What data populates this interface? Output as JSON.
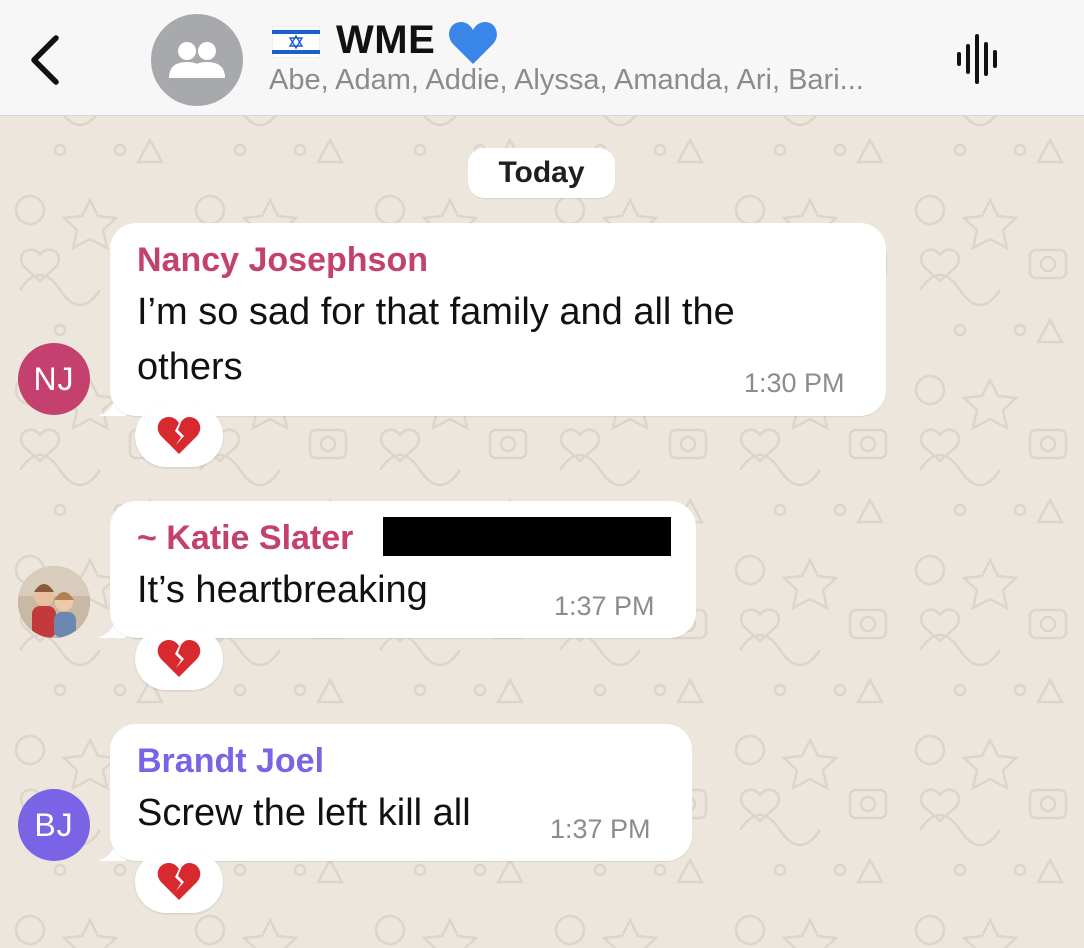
{
  "header": {
    "back_icon": "chevron-left-icon",
    "group_avatar_icon": "people-icon",
    "flag_icon": "israel-flag-icon",
    "title": "WME",
    "heart_icon": "blue-heart-icon",
    "members": "Abe, Adam, Addie, Alyssa, Amanda, Ari, Bari...",
    "audio_icon": "audio-waveform-icon"
  },
  "date_separator": "Today",
  "messages": [
    {
      "sender": "Nancy Josephson",
      "sender_color": "#c4406f",
      "avatar_initials": "NJ",
      "avatar_color": "#c4406f",
      "text_line1": "I’m so sad for that family and all the",
      "text_line2": "others",
      "time": "1:30 PM",
      "reaction": "broken-heart-icon"
    },
    {
      "sender": "~ Katie Slater",
      "sender_color": "#c4406f",
      "avatar_type": "photo",
      "redacted": true,
      "text_line1": "It’s heartbreaking",
      "time": "1:37 PM",
      "reaction": "broken-heart-icon"
    },
    {
      "sender": "Brandt Joel",
      "sender_color": "#7b63e6",
      "avatar_initials": "BJ",
      "avatar_color": "#7b63e6",
      "text_line1": "Screw the left kill all",
      "time": "1:37 PM",
      "reaction": "broken-heart-icon"
    }
  ],
  "colors": {
    "background": "#ece6dd",
    "bubble": "#ffffff",
    "header": "#f7f7f7",
    "accent_blue": "#3a86e8"
  }
}
